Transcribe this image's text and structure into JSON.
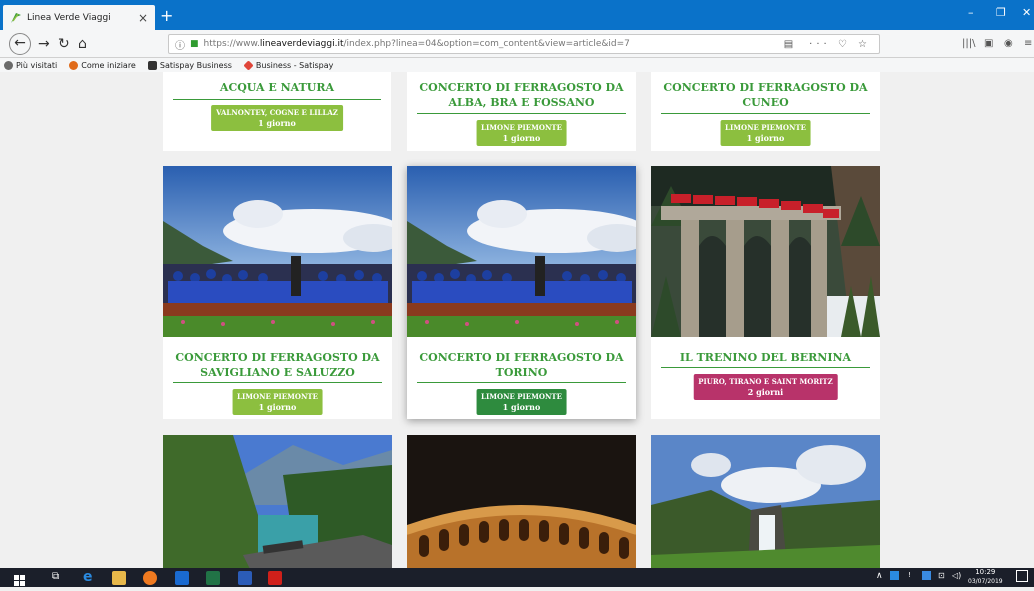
{
  "browser": {
    "tab_title": "Linea Verde Viaggi",
    "tab_close": "×",
    "new_tab": "+",
    "url_prefix": "https://www.",
    "url_domain": "lineaverdeviaggi.it",
    "url_path": "/index.php?linea=04&option=com_content&view=article&id=7",
    "url_actions": "··· ♡ ☆",
    "win_min": "–",
    "win_max": "❐",
    "win_close": "✕"
  },
  "bookmarks": [
    {
      "label": "Più visitati",
      "color": "#6a6a6a"
    },
    {
      "label": "Come iniziare",
      "color": "#e06b1a"
    },
    {
      "label": "Satispay Business",
      "color": "#333333"
    },
    {
      "label": "Business - Satispay",
      "color": "#e0463a"
    }
  ],
  "cards": [
    {
      "title": "ACQUA E NATURA",
      "badge_line1": "VALNONTEY, COGNE E LILLAZ",
      "badge_line2": "1 giorno",
      "badge_color": "lime"
    },
    {
      "title": "CONCERTO DI FERRAGOSTO DA ALBA, BRA E FOSSANO",
      "badge_line1": "LIMONE PIEMONTE",
      "badge_line2": "1 giorno",
      "badge_color": "lime"
    },
    {
      "title": "CONCERTO DI FERRAGOSTO DA CUNEO",
      "badge_line1": "LIMONE PIEMONTE",
      "badge_line2": "1 giorno",
      "badge_color": "lime"
    },
    {
      "title": "CONCERTO DI FERRAGOSTO DA SAVIGLIANO E SALUZZO",
      "badge_line1": "LIMONE PIEMONTE",
      "badge_line2": "1 giorno",
      "badge_color": "lime",
      "image": "orchestra"
    },
    {
      "title": "CONCERTO DI FERRAGOSTO DA TORINO",
      "badge_line1": "LIMONE PIEMONTE",
      "badge_line2": "1 giorno",
      "badge_color": "dark",
      "image": "orchestra"
    },
    {
      "title": "IL TRENINO DEL BERNINA",
      "badge_line1": "PIURO, TIRANO E SAINT MORITZ",
      "badge_line2": "2 giorni",
      "badge_color": "magenta",
      "image": "viaduct"
    },
    {
      "image": "lake-train"
    },
    {
      "image": "arena"
    },
    {
      "image": "waterfall"
    }
  ],
  "taskbar": {
    "time": "10:29",
    "date": "03/07/2019"
  }
}
